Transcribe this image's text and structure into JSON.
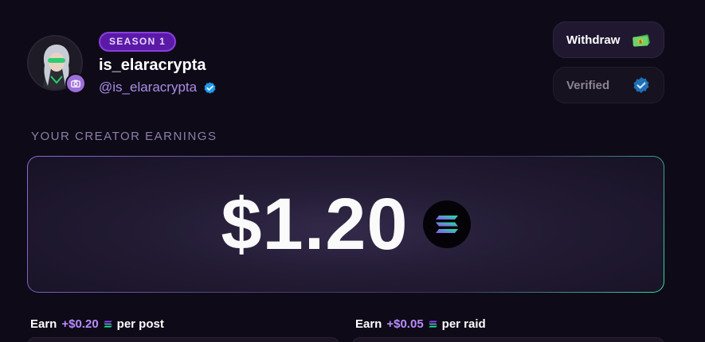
{
  "profile": {
    "season_badge": "SEASON 1",
    "username": "is_elaracrypta",
    "handle": "@is_elaracrypta"
  },
  "actions": {
    "withdraw_label": "Withdraw",
    "verified_label": "Verified"
  },
  "earnings": {
    "section_title": "YOUR CREATOR EARNINGS",
    "amount": "$1.20"
  },
  "rates": [
    {
      "prefix": "Earn",
      "rate": "+$0.20",
      "suffix": "per post"
    },
    {
      "prefix": "Earn",
      "rate": "+$0.05",
      "suffix": "per raid"
    }
  ],
  "icons": {
    "camera": "camera-icon",
    "verified": "verified-check-icon",
    "money": "money-icon",
    "solana": "solana-icon"
  },
  "colors": {
    "background": "#0f0a18",
    "accent_purple": "#8b3ee0",
    "handle": "#a98ee6",
    "verified_blue": "#1d9bf0",
    "rate": "#b88cff"
  }
}
